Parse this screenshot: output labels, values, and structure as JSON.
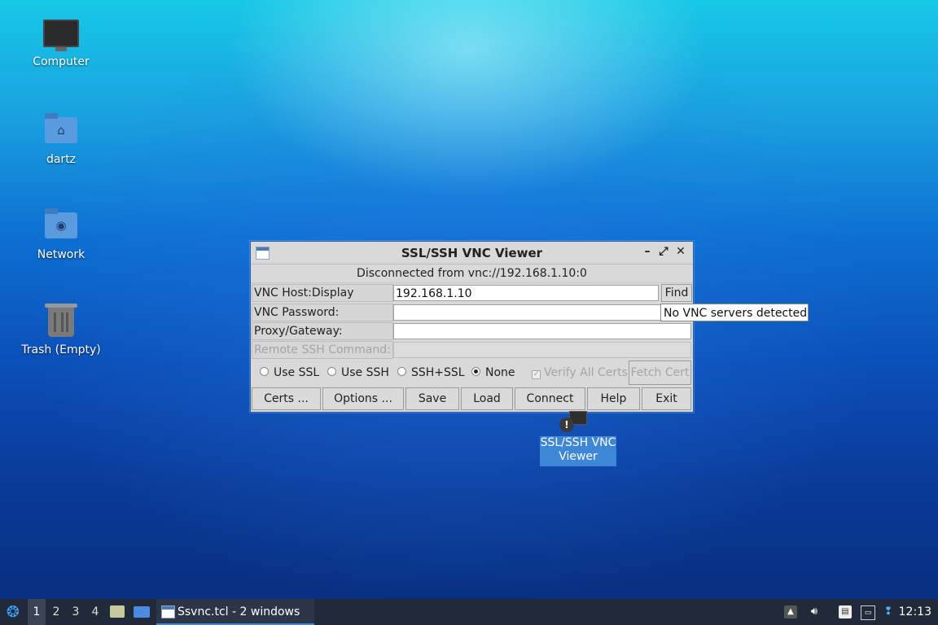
{
  "desktop": {
    "icons": [
      {
        "label": "Computer"
      },
      {
        "label": "dartz"
      },
      {
        "label": "Network"
      },
      {
        "label": "Trash (Empty)"
      }
    ],
    "selected_icon": {
      "label": "SSL/SSH VNC Viewer"
    }
  },
  "dialog": {
    "title": "SSL/SSH VNC Viewer",
    "status": "Disconnected from vnc://192.168.1.10:0",
    "fields": {
      "host_label": "VNC Host:Display",
      "host_value": "192.168.1.10",
      "password_label": "VNC Password:",
      "proxy_label": "Proxy/Gateway:",
      "ssh_cmd_label": "Remote SSH Command:"
    },
    "find_label": "Find",
    "tooltip": "No VNC servers detected",
    "radios": [
      {
        "label": "Use SSL",
        "selected": false
      },
      {
        "label": "Use SSH",
        "selected": false
      },
      {
        "label": "SSH+SSL",
        "selected": false
      },
      {
        "label": "None",
        "selected": true
      }
    ],
    "verify_label": "Verify All Certs",
    "fetch_cert_label": "Fetch Cert",
    "buttons": {
      "certs": "Certs ...",
      "options": "Options ...",
      "save": "Save",
      "load": "Load",
      "connect": "Connect",
      "help": "Help",
      "exit": "Exit"
    }
  },
  "taskbar": {
    "workspaces": [
      "1",
      "2",
      "3",
      "4"
    ],
    "active_workspace": "1",
    "task_label": "Ssvnc.tcl - 2 windows",
    "clock": "12:13"
  }
}
